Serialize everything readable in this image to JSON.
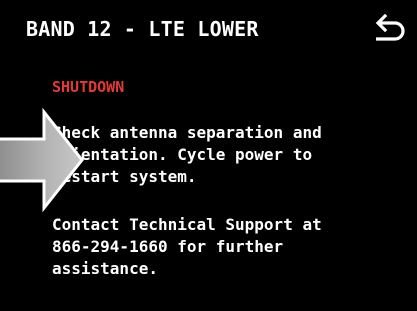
{
  "header": {
    "title": "BAND 12 - LTE LOWER"
  },
  "status": {
    "label": "SHUTDOWN",
    "color": "#e53935"
  },
  "message": {
    "instructions_lines": [
      "Check antenna separation and",
      "orientation. Cycle power to",
      "restart system."
    ],
    "support_lines": [
      "Contact Technical Support at",
      "866-294-1660 for further",
      "assistance."
    ]
  },
  "icons": {
    "back": "back-arrow-icon",
    "pointer": "right-arrow-pointer-icon"
  }
}
